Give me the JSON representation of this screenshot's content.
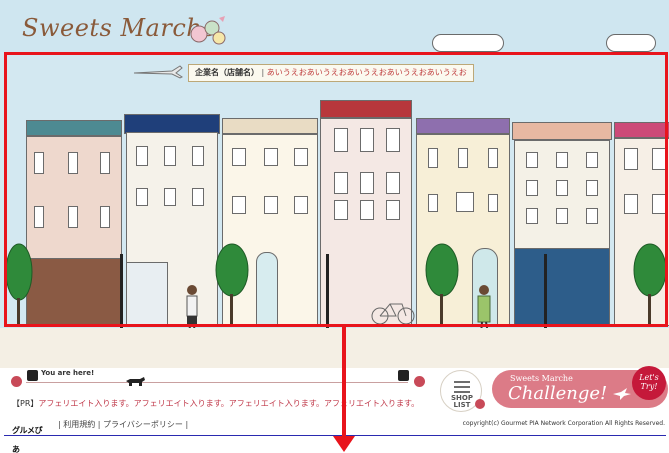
{
  "header": {
    "logo_text": "Sweets Marche"
  },
  "banner": {
    "company_label": "企業名（店舗名）",
    "separator": "|",
    "text": "あいうえおあいうえおあいうえおあいうえおあいうえお"
  },
  "progress": {
    "here_label": "You are here!"
  },
  "shop_list": {
    "label_line1": "SHOP",
    "label_line2": "LIST"
  },
  "challenge": {
    "small_label": "Sweets Marche",
    "big_label": "Challenge!",
    "badge_line1": "Let's",
    "badge_line2": "Try!"
  },
  "pr": {
    "tag": "【PR】",
    "text": "アフェリエイト入ります。アフェリエイト入ります。アフェリエイト入ります。アフェリエイト入ります。"
  },
  "footer": {
    "logo_text": "グルメぴあ",
    "link_terms": "利用規約",
    "link_privacy": "プライバシーポリシー",
    "copyright": "copyright(c) Gourmet PIA Network Corporation All Rights Reserved."
  },
  "colors": {
    "accent_red": "#e8141c",
    "sky": "#d3e8f1",
    "pink": "#dc7b87"
  }
}
